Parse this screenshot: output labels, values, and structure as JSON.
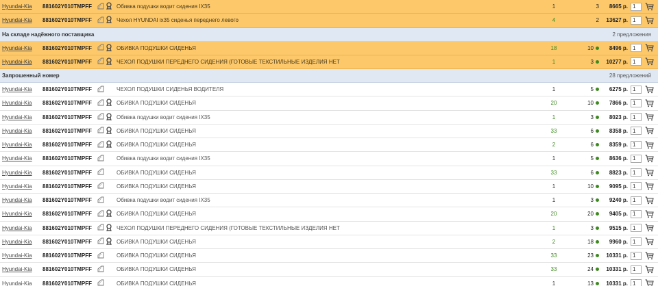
{
  "colors": {
    "highlight": "#fcc86a",
    "section": "#dfe8f3",
    "green": "#3c8a1e"
  },
  "top_rows": [
    {
      "brand": "Hyundai-Kia",
      "article": "881602Y010TMPFF",
      "desc": "Обивка подушки водит сидения IX35",
      "qty": "1",
      "qty_green": false,
      "stock": "3",
      "dot": false,
      "price": "8665 р.",
      "count": "1",
      "icons": [
        "box-icon",
        "award-icon"
      ]
    },
    {
      "brand": "Hyundai-Kia",
      "article": "881602Y010TMPFF",
      "desc": "Чехол HYUNDAI ix35 сиденья переднего левого",
      "qty": "4",
      "qty_green": true,
      "stock": "2",
      "dot": false,
      "price": "13627 р.",
      "count": "1",
      "icons": [
        "box-icon",
        "award-icon"
      ]
    }
  ],
  "section_reliable": {
    "title": "На складе надёжного поставщика",
    "count": "2 предложения"
  },
  "reliable_rows": [
    {
      "brand": "Hyundai-Kia",
      "article": "881602Y010TMPFF",
      "desc": "ОБИВКА ПОДУШКИ СИДЕНЬЯ",
      "qty": "18",
      "qty_green": true,
      "stock": "10",
      "dot": true,
      "price": "8496 р.",
      "count": "1",
      "icons": [
        "box-icon",
        "award-icon"
      ]
    },
    {
      "brand": "Hyundai-Kia",
      "article": "881602Y010TMPFF",
      "desc": "ЧЕХОЛ ПОДУШКИ ПЕРЕДНЕГО СИДЕНИЯ (ГОТОВЫЕ ТЕКСТИЛЬНЫЕ ИЗДЕЛИЯ НЕТ",
      "qty": "1",
      "qty_green": true,
      "stock": "3",
      "dot": true,
      "price": "10277 р.",
      "count": "1",
      "icons": [
        "box-icon",
        "award-icon"
      ]
    }
  ],
  "section_requested": {
    "title": "Запрошенный номер",
    "count": "28 предложений"
  },
  "requested_rows": [
    {
      "brand": "Hyundai-Kia",
      "article": "881602Y010TMPFF",
      "desc": "ЧЕХОЛ ПОДУШКИ СИДЕНЬЯ ВОДИТЕЛЯ",
      "qty": "1",
      "qty_green": false,
      "stock": "5",
      "dot": true,
      "price": "6275 р.",
      "count": "1",
      "icons": [
        "box-icon"
      ]
    },
    {
      "brand": "Hyundai-Kia",
      "article": "881602Y010TMPFF",
      "desc": "ОБИВКА ПОДУШКИ СИДЕНЬЯ",
      "qty": "20",
      "qty_green": true,
      "stock": "10",
      "dot": true,
      "price": "7866 р.",
      "count": "1",
      "icons": [
        "box-icon",
        "award-icon"
      ]
    },
    {
      "brand": "Hyundai-Kia",
      "article": "881602Y010TMPFF",
      "desc": "Обивка подушки водит сидения IX35",
      "qty": "1",
      "qty_green": true,
      "stock": "3",
      "dot": true,
      "price": "8023 р.",
      "count": "1",
      "icons": [
        "box-icon",
        "award-icon"
      ]
    },
    {
      "brand": "Hyundai-Kia",
      "article": "881602Y010TMPFF",
      "desc": "ОБИВКА ПОДУШКИ СИДЕНЬЯ",
      "qty": "33",
      "qty_green": true,
      "stock": "6",
      "dot": true,
      "price": "8358 р.",
      "count": "1",
      "icons": [
        "box-icon",
        "award-icon"
      ]
    },
    {
      "brand": "Hyundai-Kia",
      "article": "881602Y010TMPFF",
      "desc": "ОБИВКА ПОДУШКИ СИДЕНЬЯ",
      "qty": "2",
      "qty_green": true,
      "stock": "6",
      "dot": true,
      "price": "8359 р.",
      "count": "1",
      "icons": [
        "box-icon",
        "award-icon"
      ]
    },
    {
      "brand": "Hyundai-Kia",
      "article": "881602Y010TMPFF",
      "desc": "Обивка подушки водит сидения IX35",
      "qty": "1",
      "qty_green": false,
      "stock": "5",
      "dot": true,
      "price": "8636 р.",
      "count": "1",
      "icons": [
        "box-icon"
      ]
    },
    {
      "brand": "Hyundai-Kia",
      "article": "881602Y010TMPFF",
      "desc": "ОБИВКА ПОДУШКИ СИДЕНЬЯ",
      "qty": "33",
      "qty_green": true,
      "stock": "6",
      "dot": true,
      "price": "8823 р.",
      "count": "1",
      "icons": [
        "box-icon"
      ]
    },
    {
      "brand": "Hyundai-Kia",
      "article": "881602Y010TMPFF",
      "desc": "ОБИВКА ПОДУШКИ СИДЕНЬЯ",
      "qty": "1",
      "qty_green": false,
      "stock": "10",
      "dot": true,
      "price": "9095 р.",
      "count": "1",
      "icons": [
        "box-icon"
      ]
    },
    {
      "brand": "Hyundai-Kia",
      "article": "881602Y010TMPFF",
      "desc": "Обивка подушки водит сидения IX35",
      "qty": "1",
      "qty_green": false,
      "stock": "3",
      "dot": true,
      "price": "9240 р.",
      "count": "1",
      "icons": [
        "box-icon"
      ]
    },
    {
      "brand": "Hyundai-Kia",
      "article": "881602Y010TMPFF",
      "desc": "ОБИВКА ПОДУШКИ СИДЕНЬЯ",
      "qty": "20",
      "qty_green": true,
      "stock": "20",
      "dot": true,
      "price": "9405 р.",
      "count": "1",
      "icons": [
        "box-icon",
        "award-icon"
      ]
    },
    {
      "brand": "Hyundai-Kia",
      "article": "881602Y010TMPFF",
      "desc": "ЧЕХОЛ ПОДУШКИ ПЕРЕДНЕГО СИДЕНИЯ (ГОТОВЫЕ ТЕКСТИЛЬНЫЕ ИЗДЕЛИЯ НЕТ",
      "qty": "1",
      "qty_green": true,
      "stock": "3",
      "dot": true,
      "price": "9515 р.",
      "count": "1",
      "icons": [
        "box-icon",
        "award-icon"
      ]
    },
    {
      "brand": "Hyundai-Kia",
      "article": "881602Y010TMPFF",
      "desc": "ОБИВКА ПОДУШКИ СИДЕНЬЯ",
      "qty": "2",
      "qty_green": true,
      "stock": "18",
      "dot": true,
      "price": "9960 р.",
      "count": "1",
      "icons": [
        "box-icon",
        "award-icon"
      ]
    },
    {
      "brand": "Hyundai-Kia",
      "article": "881602Y010TMPFF",
      "desc": "ОБИВКА ПОДУШКИ СИДЕНЬЯ",
      "qty": "33",
      "qty_green": true,
      "stock": "23",
      "dot": true,
      "price": "10331 р.",
      "count": "1",
      "icons": [
        "box-icon"
      ]
    },
    {
      "brand": "Hyundai-Kia",
      "article": "881602Y010TMPFF",
      "desc": "ОБИВКА ПОДУШКИ СИДЕНЬЯ",
      "qty": "33",
      "qty_green": true,
      "stock": "24",
      "dot": true,
      "price": "10331 р.",
      "count": "1",
      "icons": [
        "box-icon"
      ]
    },
    {
      "brand": "Hyundai-Kia",
      "article": "881602Y010TMPFF",
      "desc": "ОБИВКА ПОДУШКИ СИДЕНЬЯ",
      "qty": "1",
      "qty_green": false,
      "stock": "13",
      "dot": true,
      "price": "10331 р.",
      "count": "1",
      "icons": [
        "box-icon"
      ]
    }
  ]
}
